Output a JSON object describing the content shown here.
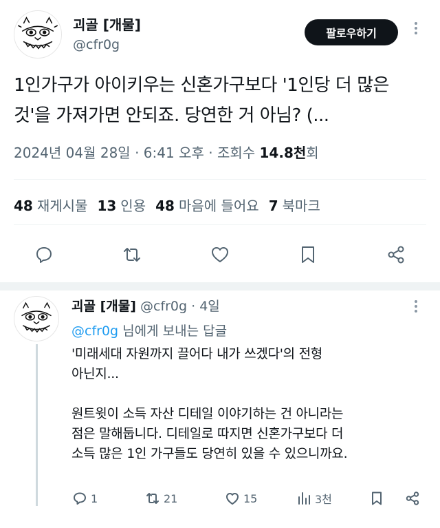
{
  "tweet": {
    "author_name": "괴골 [개물]",
    "author_handle": "@cfr0g",
    "follow_label": "팔로우하기",
    "text_lines": [
      "1인가구가 아이키우는 신혼가구보다 '1인당 더 많은",
      "것'을 가져가면 안되죠. 당연한 거 아님? (..."
    ],
    "date": "2024년 04월 28일",
    "time": "6:41 오후",
    "views_label": "조회수",
    "views_value": "14.8천",
    "views_suffix": "회",
    "separator": "·"
  },
  "stats": [
    {
      "count": "48",
      "label": "재게시물"
    },
    {
      "count": "13",
      "label": "인용"
    },
    {
      "count": "48",
      "label": "마음에 들어요"
    },
    {
      "count": "7",
      "label": "북마크"
    }
  ],
  "actions": [
    "reply-icon",
    "retweet-icon",
    "like-icon",
    "bookmark-icon",
    "share-icon"
  ],
  "reply": {
    "author_name": "괴골 [개물]",
    "author_handle": "@cfr0g",
    "separator": "·",
    "age": "4일",
    "reply_to_mention": "@cfr0g",
    "reply_to_suffix": "님에게 보내는 답글",
    "text": "'미래세대 자원까지 끌어다 내가 쓰겠다'의 전형\n아닌지...\n\n원트윗이 소득 자산 디테일 이야기하는 건 아니라는\n점은 말해둡니다. 디테일로 따지면 신혼가구보다 더\n소득 많은 1인 가구들도 당연히 있을 수 있으니까요.",
    "reply_count": "1",
    "retweet_count": "21",
    "like_count": "15",
    "views_count": "3천"
  },
  "colors": {
    "text": "#0f1419",
    "secondary": "#536471",
    "accent": "#1d9bf0",
    "button_bg": "#0f1419"
  }
}
